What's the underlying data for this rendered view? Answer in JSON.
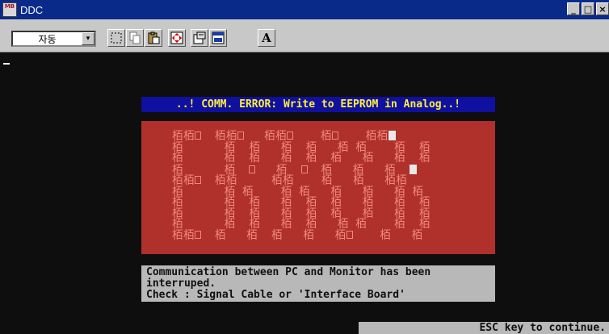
{
  "window": {
    "title": "DDC",
    "icon_label": "MB",
    "minimize_label": "_",
    "maximize_label": "□",
    "close_label": "×"
  },
  "toolbar": {
    "combo_value": "자동",
    "combo_arrow": "▾",
    "font_button_label": "A",
    "buttons": [
      "select-icon",
      "copy-icon",
      "paste-icon",
      "fullscreen-icon",
      "properties-icon",
      "background-icon",
      "font-icon"
    ]
  },
  "screen": {
    "error_banner": "..! COMM. ERROR: Write to EEPROM in Analog..!",
    "message_lines": [
      "Communication between PC and Monitor has been",
      "interruped.",
      "Check : Signal Cable or 'Interface Board'"
    ],
    "continue_prompt": "ESC key to continue.",
    "colors": {
      "background": "#0e0e0e",
      "banner_bg": "#1010a0",
      "banner_text": "#ffef3c",
      "error_panel": "#b0302c",
      "panel_glyph": "#f08a7c",
      "info_panel": "#b8b8b8"
    }
  }
}
